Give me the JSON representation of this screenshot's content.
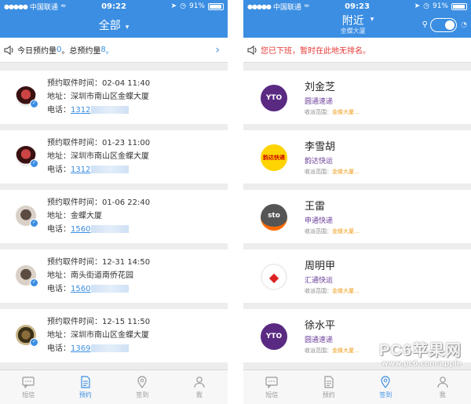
{
  "left": {
    "status": {
      "carrier": "中国联通",
      "time": "09:22",
      "battery": "91%"
    },
    "nav": {
      "title": "全部"
    },
    "notice": {
      "prefix": "今日预约量",
      "today": "0",
      "mid": "。总预约量",
      "total": "8",
      "suffix": "。"
    },
    "appointments": [
      {
        "time": "预约取件时间：02-04 11:40",
        "address": "地址：深圳市南山区金蝶大厦",
        "phone_label": "电话：",
        "phone": "1312"
      },
      {
        "time": "预约取件时间：01-23 11:00",
        "address": "地址：深圳市南山区金蝶大厦",
        "phone_label": "电话：",
        "phone": "1312"
      },
      {
        "time": "预约取件时间：01-06 22:40",
        "address": "地址：金蝶大厦",
        "phone_label": "电话：",
        "phone": "1560"
      },
      {
        "time": "预约取件时间：12-31 14:50",
        "address": "地址：南头街道南侨花园",
        "phone_label": "电话：",
        "phone": "1560"
      },
      {
        "time": "预约取件时间：12-15 11:50",
        "address": "地址：深圳市南山区金蝶大厦",
        "phone_label": "电话：",
        "phone": "1369"
      }
    ],
    "tabs": [
      {
        "label": "短信",
        "icon": "message-icon"
      },
      {
        "label": "预约",
        "icon": "document-icon",
        "active": true
      },
      {
        "label": "签到",
        "icon": "location-icon"
      },
      {
        "label": "我",
        "icon": "person-icon"
      }
    ]
  },
  "right": {
    "status": {
      "carrier": "中国联通",
      "time": "09:23",
      "battery": "91%"
    },
    "nav": {
      "title": "附近",
      "subtitle": "金蝶大厦"
    },
    "notice": {
      "text": "您已下班，暂时在此地无排名。"
    },
    "couriers": [
      {
        "name": "刘金芝",
        "company": "圆通速递",
        "range_label": "收派范围：",
        "range": "金蝶大厦...",
        "logo": "yto-logo",
        "logo_text": "YTO"
      },
      {
        "name": "李雪胡",
        "company": "韵达快运",
        "range_label": "收派范围：",
        "range": "金蝶大厦...",
        "logo": "yunda-logo",
        "logo_text": "韵达快递"
      },
      {
        "name": "王雷",
        "company": "申通快递",
        "range_label": "收派范围：",
        "range": "金蝶大厦...",
        "logo": "sto-logo",
        "logo_text": "sto"
      },
      {
        "name": "周明甲",
        "company": "汇通快运",
        "range_label": "收派范围：",
        "range": "金蝶大厦...",
        "logo": "huitong-logo",
        "logo_text": "◆"
      },
      {
        "name": "徐水平",
        "company": "圆通速递",
        "range_label": "收派范围：",
        "range": "金蝶大厦...",
        "logo": "yto-logo",
        "logo_text": "YTO"
      }
    ],
    "tabs": [
      {
        "label": "短信",
        "icon": "message-icon"
      },
      {
        "label": "预约",
        "icon": "document-icon"
      },
      {
        "label": "签到",
        "icon": "location-icon",
        "active": true
      },
      {
        "label": "我",
        "icon": "person-icon"
      }
    ]
  },
  "watermark": {
    "main": "PC6苹果网",
    "url": "www.pc6.com/apple"
  },
  "colors": {
    "primary": "#3b8ee2",
    "alert": "#e53935",
    "range": "#f0a020"
  }
}
